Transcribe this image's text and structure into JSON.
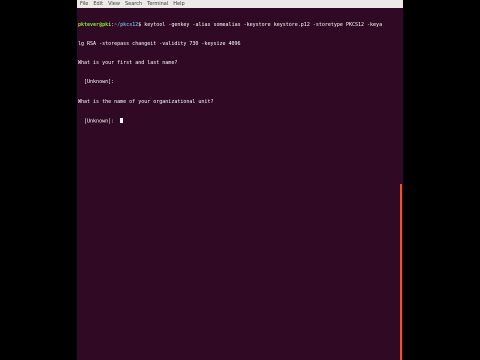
{
  "menubar": {
    "items": [
      "File",
      "Edit",
      "View",
      "Search",
      "Terminal",
      "Help"
    ]
  },
  "terminal": {
    "prompt_user": "pktever@pki",
    "prompt_sep": ":",
    "prompt_path": "~/pkcs12",
    "prompt_end": "$ ",
    "command_line1": "keytool -genkey -alias somealias -keystore keystore.p12 -storetype PKCS12 -keya",
    "command_line2": "lg RSA -storepass changeit -validity 730 -keysize 4096",
    "q1": "What is your first and last name?",
    "a1": "  [Unknown]:",
    "q2": "What is the name of your organizational unit?",
    "a2": "  [Unknown]:  "
  },
  "colors": {
    "background": "#300a24",
    "scrollbar": "#e95420",
    "prompt_user": "#8ae234",
    "prompt_path": "#729fcf"
  }
}
